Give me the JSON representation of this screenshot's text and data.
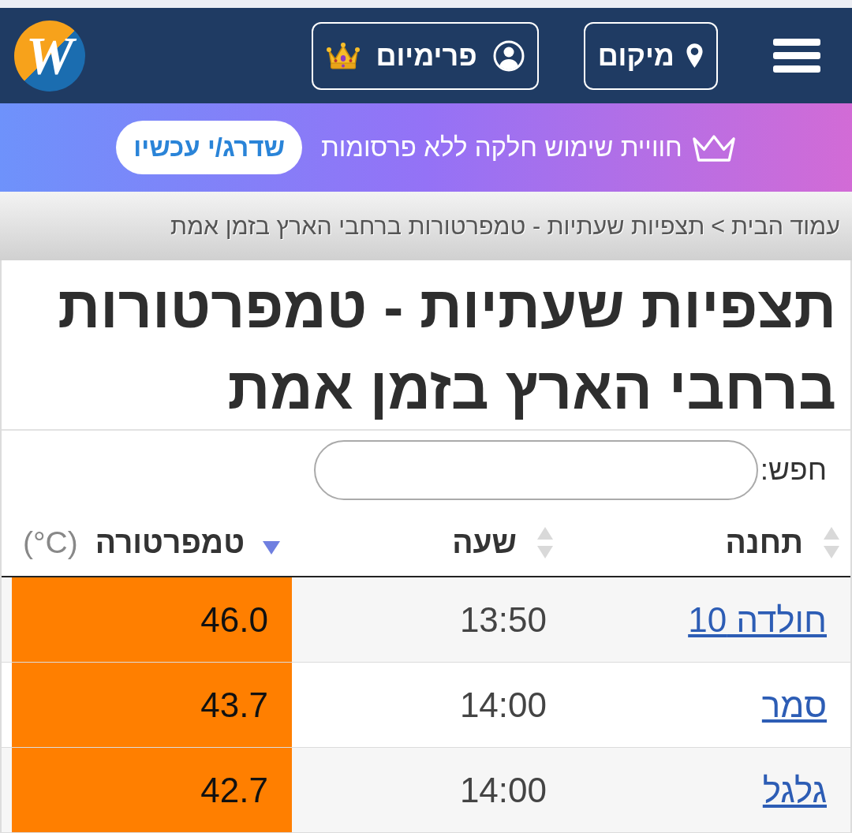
{
  "header": {
    "buttons": [
      {
        "kind": "location",
        "label": "מיקום"
      },
      {
        "kind": "premium",
        "label": "פרימיום"
      }
    ],
    "logo": {
      "text": "W"
    }
  },
  "banner": {
    "text": "חוויית שימוש חלקה ללא פרסומות",
    "button": "שדרג/י עכשיו"
  },
  "breadcrumb": {
    "items": [
      "עמוד הבית",
      "תצפיות שעתיות - טמפרטורות ברחבי הארץ בזמן אמת"
    ],
    "separator": ">"
  },
  "title": "תצפיות שעתיות - טמפרטורות ברחבי הארץ בזמן אמת",
  "search": {
    "label": "חפש:"
  },
  "table": {
    "columns": [
      {
        "label": "תחנה",
        "sorted": false
      },
      {
        "label": "שעה",
        "sorted": false
      },
      {
        "label": "טמפרטורה",
        "unit": "(°C)",
        "sorted": true,
        "descending": true
      }
    ],
    "rows": [
      {
        "station": "חולדה 10",
        "time": "13:50",
        "temperature": "46.0",
        "color": "#ff7f00"
      },
      {
        "station": "סמר",
        "time": "14:00",
        "temperature": "43.7",
        "color": "#ff7f00"
      },
      {
        "station": "גלגל",
        "time": "14:00",
        "temperature": "42.7",
        "color": "#ff7f00"
      }
    ]
  }
}
